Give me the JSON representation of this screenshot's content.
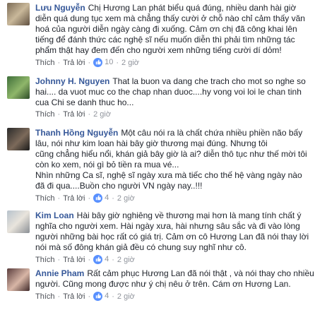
{
  "comments": [
    {
      "author": "Lưu Nguyễn",
      "text": "Chị Hương Lan phát biểu quá đúng, nhiều danh hài giờ\ndiễn quá dung tục xem mà chẳng thấy cười ở chỗ nào chỉ cảm thấy văn\nhoá của người diễn ngày càng đi xuống. Cảm ơn chị đã công khai lên\ntiếng để đánh thức các nghệ sĩ nếu muốn diễn thì phải tìm những tác\nphẩm thật hay đem đến cho người xem những tiếng cười dí dỏm!",
      "like": "Thích",
      "reply": "Trả lời",
      "reaction_count": "10",
      "time": "2 giờ"
    },
    {
      "author": "Johnny H. Nguyen",
      "text": "That la buon va dang che trach cho mot so nghe so\nhai.... da vuot muc co the chap nhan duoc....hy vong voi loi le chan tinh\ncua Chi se danh thuc ho...",
      "like": "Thích",
      "reply": "Trả lời",
      "reaction_count": "",
      "time": "2 giờ"
    },
    {
      "author": "Thanh Hồng Nguyễn",
      "text": "Một câu nói ra là chất chứa nhiều phiền não bấy\nlâu, nói như kim loan hài bây giờ thương mại đúng. Nhưng tôi\ncũng chẳng hiểu nổi, khán giả bây giờ là ai? diễn thô tục như thế mời tôi\ncòn ko xem, nói gì bỏ tiền ra mua vé...\nNhìn những Ca sĩ, nghệ sĩ ngày xưa mà tiếc cho thế hệ vàng ngày nào\nđã đi qua....Buồn cho người VN ngày nay..!!!",
      "like": "Thích",
      "reply": "Trả lời",
      "reaction_count": "4",
      "time": "2 giờ"
    },
    {
      "author": "Kim Loan",
      "text": "Hài bây giờ nghiêng về thương mại hơn là mang tính chất ý\nnghĩa cho người xem. Hài ngày xưa, hài nhưng sâu sắc và đi vào lòng\nngười những bài học rất có giá trị. Cảm ơn cô Hương Lan đã nói thay lời\nnói mà số đông khán giả đều có chung suy nghĩ như cô.",
      "like": "Thích",
      "reply": "Trả lời",
      "reaction_count": "4",
      "time": "2 giờ"
    },
    {
      "author": "Annie Pham",
      "text": "Rất cảm phục Hương Lan đã nói thật , và nói thay cho nhiều\nngười. Cũng mong được như ý chị nêu ở trên. Cám ơn Hương Lan.",
      "like": "Thích",
      "reply": "Trả lời",
      "reaction_count": "4",
      "time": "2 giờ"
    }
  ]
}
